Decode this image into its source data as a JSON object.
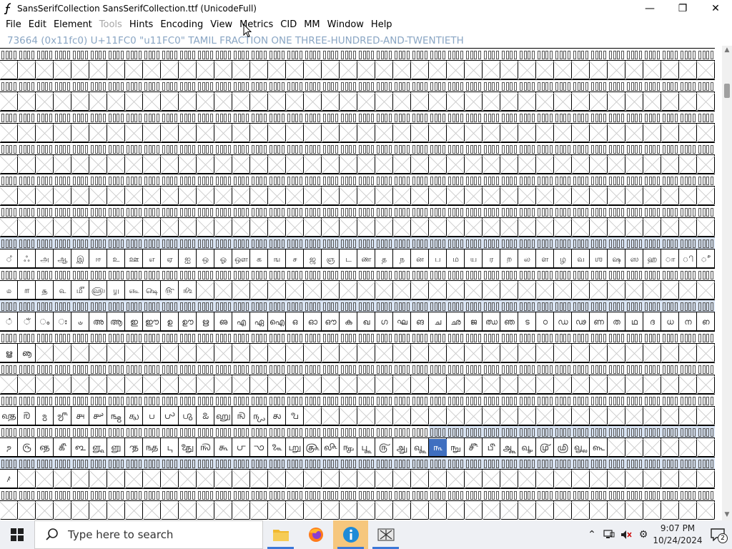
{
  "window": {
    "title": "SansSerifCollection  SansSerifCollection.ttf (UnicodeFull)",
    "controls": {
      "minimize": "—",
      "maximize": "❐",
      "close": "✕"
    }
  },
  "menu": {
    "items": [
      {
        "label": "File",
        "enabled": true
      },
      {
        "label": "Edit",
        "enabled": true
      },
      {
        "label": "Element",
        "enabled": true
      },
      {
        "label": "Tools",
        "enabled": false
      },
      {
        "label": "Hints",
        "enabled": true
      },
      {
        "label": "Encoding",
        "enabled": true
      },
      {
        "label": "View",
        "enabled": true
      },
      {
        "label": "Metrics",
        "enabled": true
      },
      {
        "label": "CID",
        "enabled": true
      },
      {
        "label": "MM",
        "enabled": true
      },
      {
        "label": "Window",
        "enabled": true
      },
      {
        "label": "Help",
        "enabled": true
      }
    ]
  },
  "info_line": "73664 (0x11fc0) U+11FC0 \"u11FC0\" TAMIL FRACTION ONE THREE-HUNDRED-AND-TWENTIETH",
  "grid": {
    "rows": [
      {
        "glyphs": ""
      },
      {
        "glyphs": ""
      },
      {
        "glyphs": ""
      },
      {
        "glyphs": ""
      },
      {
        "glyphs": ""
      },
      {
        "glyphs": ""
      },
      {
        "glyphs": "ஂஃஅஆஇஈஉஊஎஏஐஒஓஔகஙசஜஞடணதநனபமயரறலளழவஶஷஸஹாிீுூெேைொோௌ்ௐௗ௦௧௨௩௪௫௬௭௮௯"
      },
      {
        "glyphs": "௰௱௲௳௴௵௶௷௸௹௺"
      },
      {
        "glyphs": "ഀഁംഃഄഅആഇഈഉഊഋഌഎഏഐഒഓഔകഖഗഘങചഛജഝഞടഠഡഢണതഥദധനഩപഫബഭമ"
      },
      {
        "glyphs": "ൠൡ"
      },
      {
        "glyphs": ""
      },
      {
        "glyphs": "𑿀𑿁𑿂𑿃𑿄𑿅𑿆𑿇𑿈𑿉𑿊𑿋𑿌𑿍𑿎𑿏𑿐"
      },
      {
        "glyphs": "𑿑𑿒𑿓𑿔𑿕𑿖𑿗𑿘𑿙𑿚𑿛𑿜𑿝𑿞𑿟𑿠𑿡𑿢𑿣𑿤𑿥𑿦𑿧𑿨𑿩𑿪𑿫𑿬𑿭𑿮𑿯𑿰𑿱𑿿"
      },
      {
        "glyphs": "ꤰ"
      },
      {
        "glyphs": ""
      }
    ]
  },
  "taskbar": {
    "search_placeholder": "Type here to search",
    "time": "9:07 PM",
    "date": "10/24/2024",
    "notification_count": "2"
  },
  "colors": {
    "selection": "#3f6fc0",
    "selection_light": "#d9e4f3",
    "info_text": "#8aa6c4",
    "taskbar_bg": "#eef0f4",
    "taskbar_accent": "#3b78d8"
  }
}
